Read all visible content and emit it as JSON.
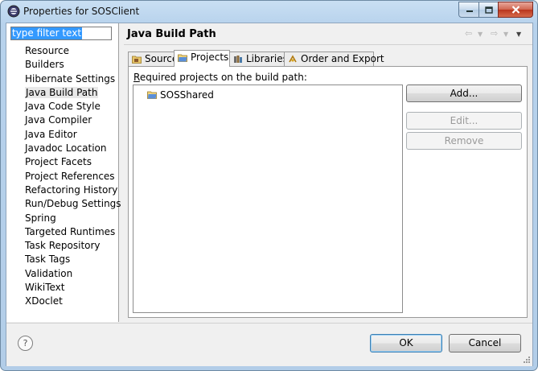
{
  "window": {
    "title": "Properties for SOSClient"
  },
  "filter": {
    "value": "type filter text"
  },
  "tree": {
    "items": [
      "Resource",
      "Builders",
      "Hibernate Settings",
      "Java Build Path",
      "Java Code Style",
      "Java Compiler",
      "Java Editor",
      "Javadoc Location",
      "Project Facets",
      "Project References",
      "Refactoring History",
      "Run/Debug Settings",
      "Spring",
      "Targeted Runtimes",
      "Task Repository",
      "Task Tags",
      "Validation",
      "WikiText",
      "XDoclet"
    ],
    "selected": "Java Build Path"
  },
  "panel": {
    "title": "Java Build Path"
  },
  "tabs": [
    {
      "label": "Source",
      "icon": "source-folder-icon"
    },
    {
      "label": "Projects",
      "icon": "project-folder-icon",
      "active": true
    },
    {
      "label": "Libraries",
      "icon": "library-icon"
    },
    {
      "label": "Order and Export",
      "icon": "order-export-icon"
    }
  ],
  "projects": {
    "label_prefix": "R",
    "label_rest": "equired projects on the build path:",
    "items": [
      "SOSShared"
    ]
  },
  "buttons": {
    "add": "Add...",
    "edit": "Edit...",
    "remove": "Remove"
  },
  "dialog": {
    "help": "?",
    "ok": "OK",
    "cancel": "Cancel"
  },
  "colors": {
    "selection": "#3399ff",
    "window_frame": "#b7d2ec",
    "close_button": "#c7452c"
  }
}
